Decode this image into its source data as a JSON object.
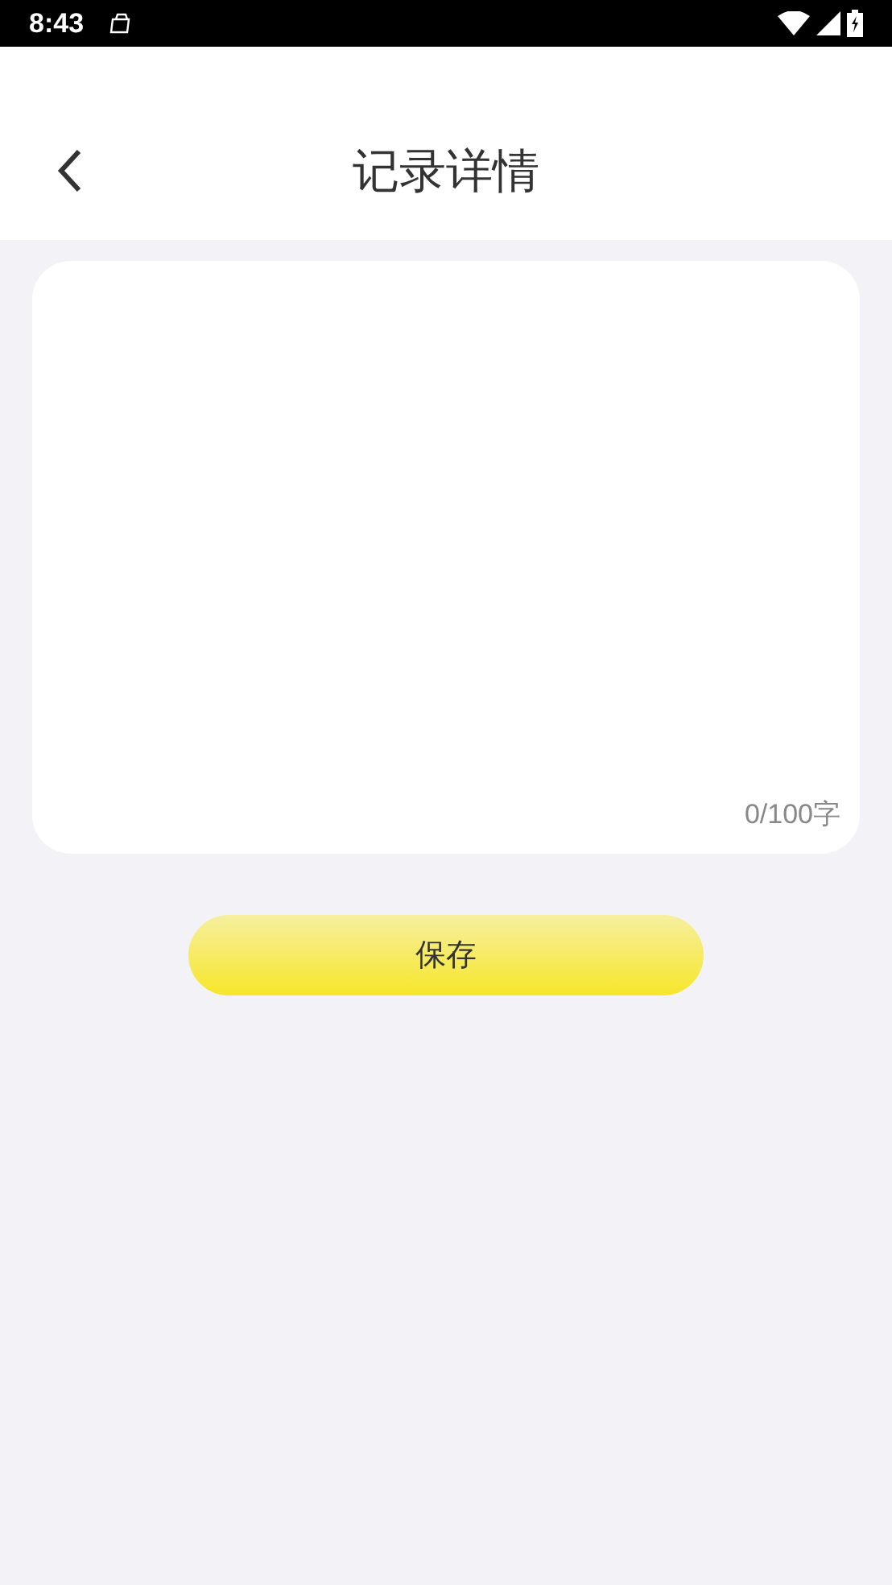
{
  "status_bar": {
    "time": "8:43"
  },
  "header": {
    "title": "记录详情"
  },
  "note": {
    "counter": "0/100字"
  },
  "save_button": {
    "label": "保存"
  }
}
